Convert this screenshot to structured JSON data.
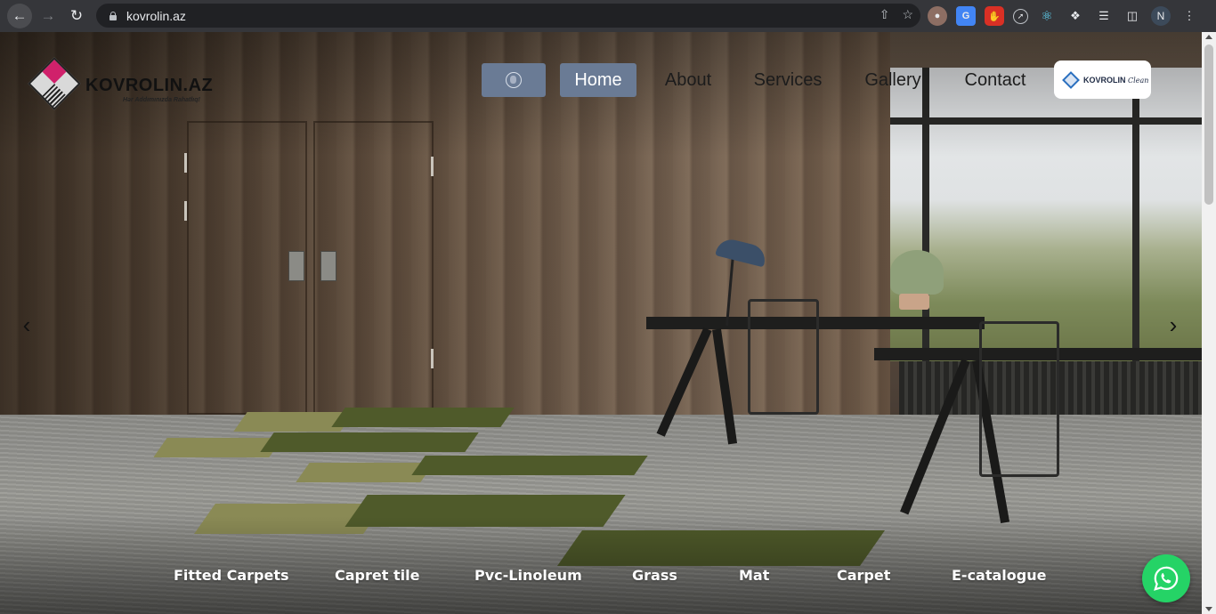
{
  "browser": {
    "url": "kovrolin.az",
    "profile_initial": "N",
    "icons": [
      "back-arrow-icon",
      "forward-arrow-icon",
      "reload-icon",
      "lock-icon",
      "share-icon",
      "star-icon",
      "extension-icon",
      "reading-list-icon",
      "side-panel-icon",
      "menu-dots-icon"
    ]
  },
  "site": {
    "logo": {
      "name": "KOVROLIN.AZ",
      "slogan": "Hər Addımınızda Rahatlıq!"
    },
    "menu": {
      "language_icon": "globe-icon",
      "items": [
        {
          "label": "Home",
          "active": true
        },
        {
          "label": "About",
          "active": false
        },
        {
          "label": "Services",
          "active": false
        },
        {
          "label": "Gallery",
          "active": false
        },
        {
          "label": "Contact",
          "active": false
        }
      ]
    },
    "clean_badge": {
      "brand": "KOVROLIN",
      "suffix": "Clean"
    },
    "slider": {
      "prev_icon": "chevron-left-icon",
      "next_icon": "chevron-right-icon"
    },
    "categories": [
      "Fitted Carpets",
      "Capret tile",
      "Pvc-Linoleum",
      "Grass",
      "Mat",
      "Carpet",
      "E-catalogue"
    ],
    "whatsapp_icon": "whatsapp-icon",
    "colors": {
      "menu_accent": "#6a7b95",
      "logo_pink": "#d0216b",
      "whatsapp_green": "#25d366"
    }
  }
}
